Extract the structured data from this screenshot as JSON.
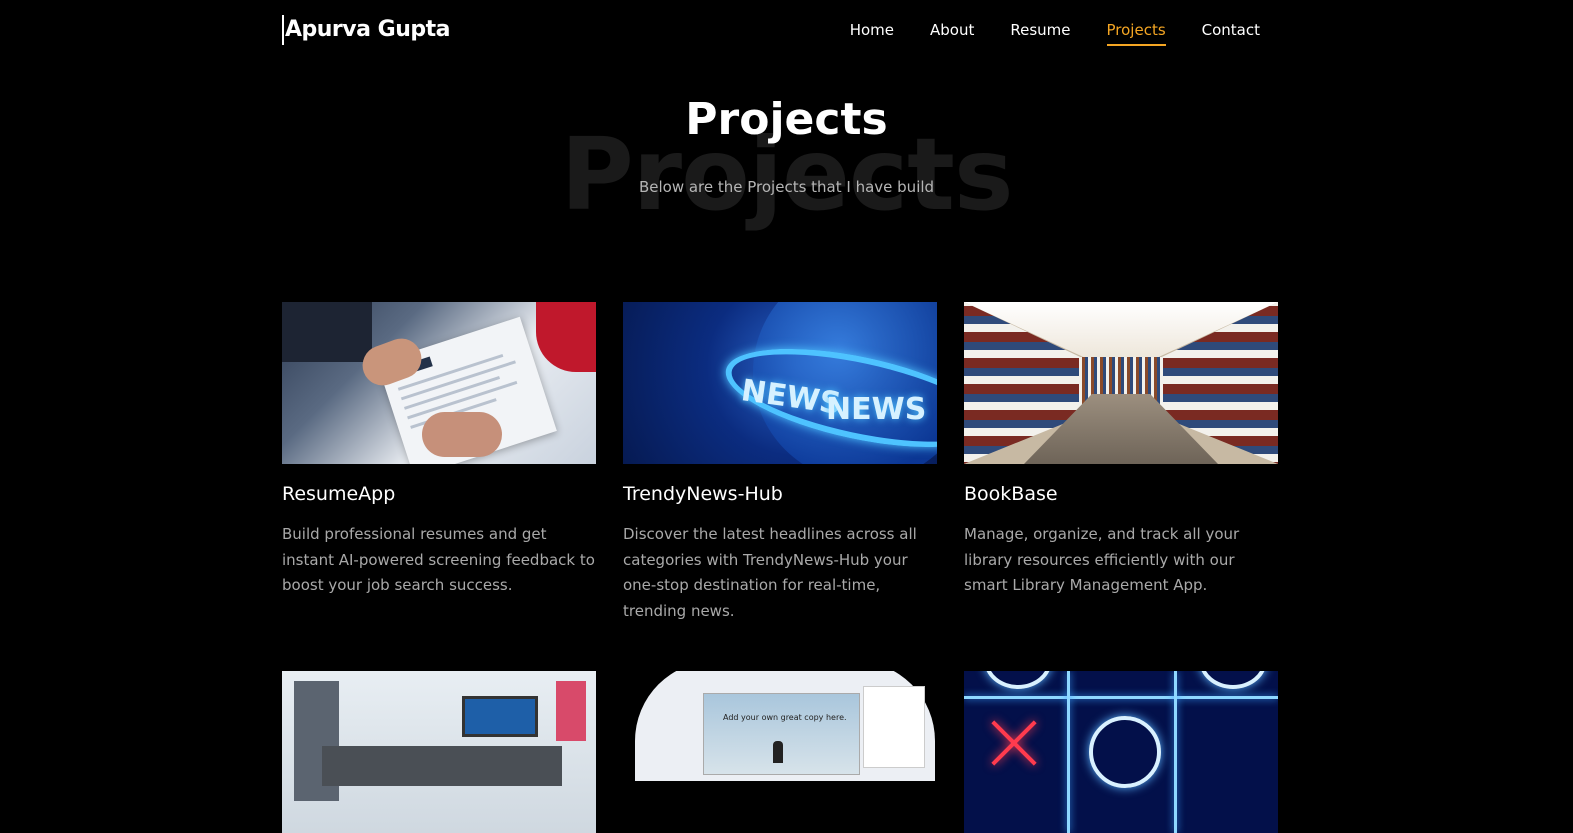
{
  "header": {
    "brand": "Apurva Gupta",
    "nav": [
      {
        "label": "Home",
        "active": false
      },
      {
        "label": "About",
        "active": false
      },
      {
        "label": "Resume",
        "active": false
      },
      {
        "label": "Projects",
        "active": true
      },
      {
        "label": "Contact",
        "active": false
      }
    ]
  },
  "hero": {
    "title": "Projects",
    "background_text": "Projects",
    "subtitle": "Below are the Projects that I have build"
  },
  "projects": [
    {
      "title": "ResumeApp",
      "description": "Build professional resumes and get instant AI-powered screening feedback to boost your job search success.",
      "image": "resume-handoff-photo"
    },
    {
      "title": "TrendyNews-Hub",
      "description": "Discover the latest headlines across all categories with TrendyNews-Hub your one-stop destination for real-time, trending news.",
      "image": "news-globe-graphic",
      "image_text": [
        "NEWS",
        "NEWS"
      ]
    },
    {
      "title": "BookBase",
      "description": "Manage, organize, and track all your library resources efficiently with our smart Library Management App.",
      "image": "library-bookshelves-photo"
    },
    {
      "title": "",
      "description": "",
      "image": "clinic-reception-photo"
    },
    {
      "title": "",
      "description": "",
      "image": "website-editor-mockup",
      "image_text": [
        "Add your own great copy here."
      ]
    },
    {
      "title": "",
      "description": "",
      "image": "neon-tic-tac-toe"
    }
  ],
  "colors": {
    "background": "#000000",
    "accent": "#f5a623",
    "text": "#ffffff",
    "muted": "#a9a9a9"
  }
}
